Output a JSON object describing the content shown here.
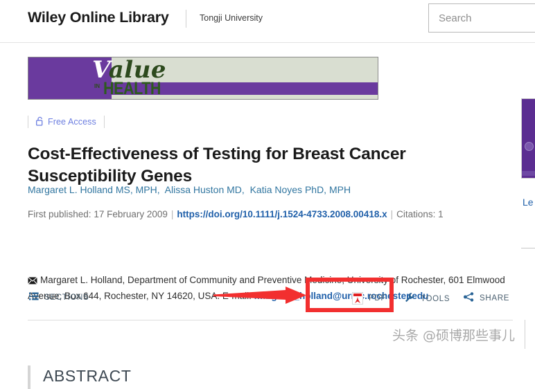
{
  "header": {
    "brand": "Wiley Online Library",
    "affiliation": "Tongji University",
    "search": {
      "placeholder": "Search",
      "value": ""
    }
  },
  "journal_banner": {
    "name": "Value in Health",
    "word_value": "alue",
    "word_value_initial": "V",
    "word_in": "IN",
    "word_health": "HEALTH",
    "colors": {
      "purple": "#6a3a9e",
      "field": "#d9ded1",
      "green": "#2d5a1e"
    }
  },
  "article": {
    "access_label": "Free Access",
    "access_icon": "open-lock-icon",
    "title": "Cost-Effectiveness of Testing for Breast Cancer Susceptibility Genes",
    "authors": [
      "Margaret L. Holland MS, MPH",
      "Alissa Huston MD",
      "Katia Noyes PhD, MPH"
    ],
    "first_published_label": "First published:",
    "first_published_date": "17 February 2009",
    "doi": "https://doi.org/10.1111/j.1524-4733.2008.00418.x",
    "citations_label": "Citations: 1",
    "correspondence": {
      "icon": "envelope-icon",
      "text": "Margaret L. Holland, Department of Community and Preventive Medicine, University of Rochester, 601 Elmwood Avenue, Box 644, Rochester, NY 14620, USA. E-mail: ",
      "email": "margaret_holland@urmc.rochester.edu"
    }
  },
  "toolbar": {
    "sections_label": "SECTIONS",
    "sections_icon": "list-icon",
    "pdf_label": "PDF",
    "pdf_icon": "pdf-icon",
    "tools_label": "TOOLS",
    "tools_icon": "wrench-icon",
    "share_label": "SHARE",
    "share_icon": "share-icon"
  },
  "abstract": {
    "heading": "ABSTRACT"
  },
  "sidebar": {
    "cover_alt": "journal-cover-thumbnail",
    "link_text": "Le"
  },
  "annotations": {
    "highlight_color": "#f22f2f",
    "arrow_name": "red-arrow-pointing-to-pdf",
    "box_name": "red-highlight-box-around-pdf"
  },
  "watermark": {
    "text": "头条 @硕博那些事儿"
  }
}
